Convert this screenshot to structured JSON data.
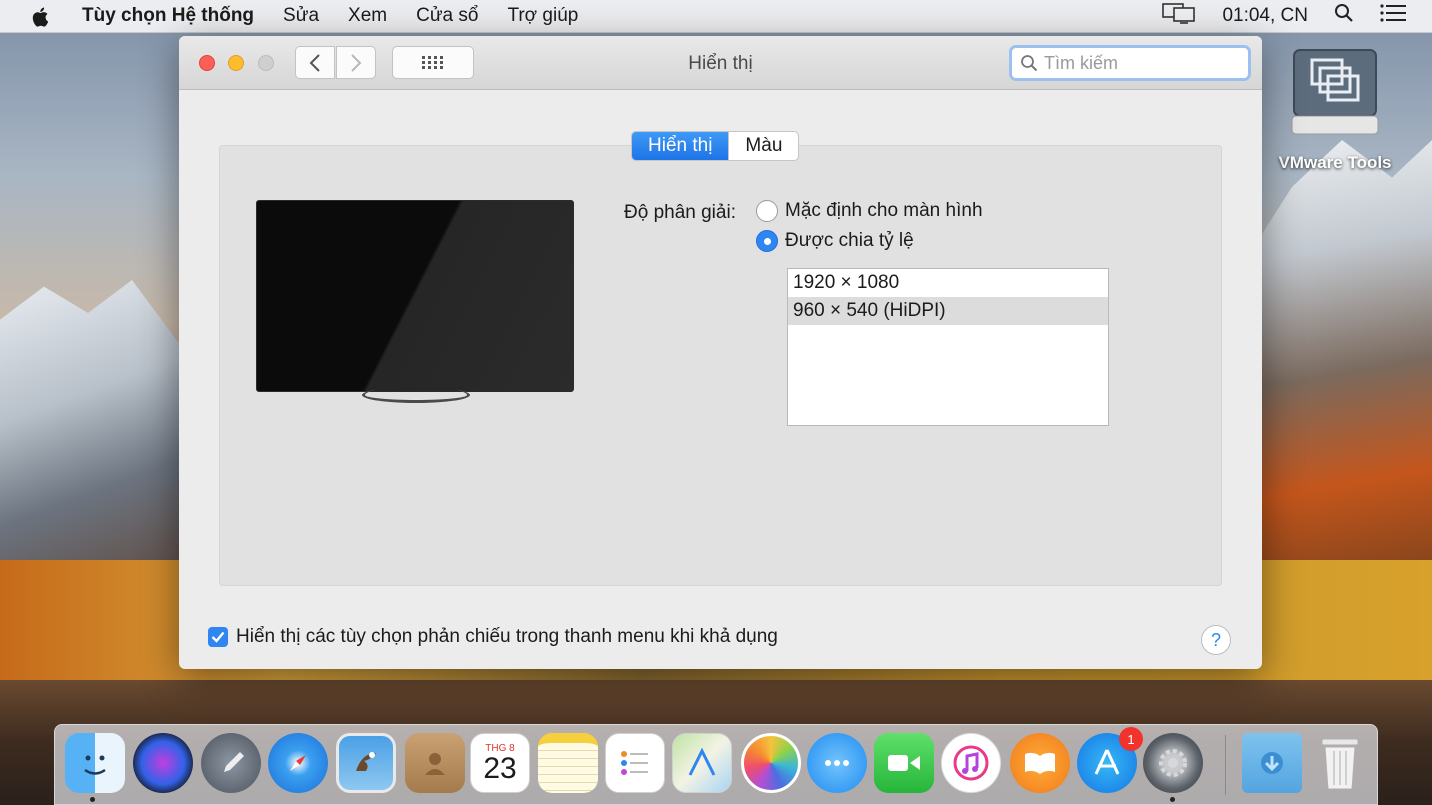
{
  "menubar": {
    "app_name": "Tùy chọn Hệ thống",
    "items": [
      "Sửa",
      "Xem",
      "Cửa sổ",
      "Trợ giúp"
    ],
    "clock": "01:04, CN"
  },
  "window": {
    "title": "Hiển thị",
    "search_placeholder": "Tìm kiếm",
    "tabs": [
      "Hiển thị",
      "Màu"
    ],
    "resolution_label": "Độ phân giải:",
    "radio_default": "Mặc định cho màn hình",
    "radio_scaled": "Được chia tỷ lệ",
    "resolutions": [
      "1920 × 1080",
      "960 × 540 (HiDPI)"
    ],
    "mirror_label": "Hiển thị các tùy chọn phản chiếu trong thanh menu khi khả dụng",
    "help": "?"
  },
  "desktop": {
    "vmware_label": "VMware Tools"
  },
  "dock": {
    "calendar_month": "THG 8",
    "calendar_day": "23",
    "appstore_badge": "1",
    "icons": [
      "finder-icon",
      "siri-icon",
      "launchpad-icon",
      "safari-icon",
      "mail-icon",
      "contacts-icon",
      "calendar-icon",
      "notes-icon",
      "reminders-icon",
      "maps-icon",
      "photos-icon",
      "messages-icon",
      "facetime-icon",
      "itunes-icon",
      "ibooks-icon",
      "app-store-icon",
      "system-preferences-icon",
      "downloads-icon",
      "trash-icon"
    ]
  },
  "colors": {
    "accent": "#2f86f3",
    "close": "#fc5f57",
    "minimize": "#fdbc2e"
  }
}
